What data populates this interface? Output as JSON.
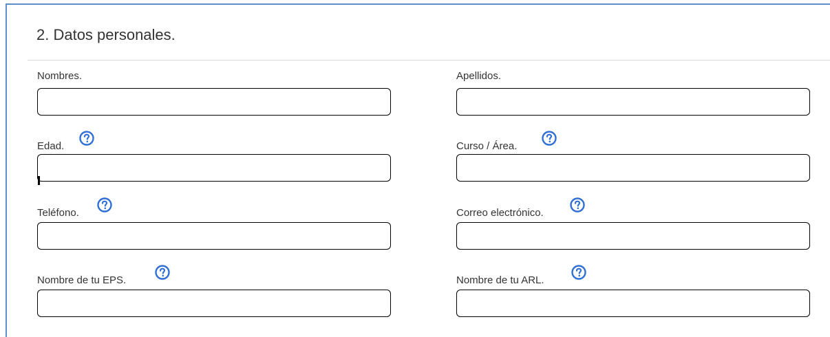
{
  "section": {
    "title": "2. Datos personales."
  },
  "fields": {
    "nombres": {
      "label": "Nombres.",
      "value": "",
      "has_help": false
    },
    "apellidos": {
      "label": "Apellidos.",
      "value": "",
      "has_help": false
    },
    "edad": {
      "label": "Edad.",
      "value": "",
      "has_help": true
    },
    "curso": {
      "label": "Curso / Área.",
      "value": "",
      "has_help": true
    },
    "telefono": {
      "label": "Teléfono.",
      "value": "",
      "has_help": true
    },
    "correo": {
      "label": "Correo electrónico.",
      "value": "",
      "has_help": true
    },
    "eps": {
      "label": "Nombre de tu EPS.",
      "value": "",
      "has_help": true
    },
    "arl": {
      "label": "Nombre de tu ARL.",
      "value": "",
      "has_help": true
    }
  },
  "icons": {
    "help": "question-circle-icon"
  },
  "colors": {
    "help_icon": "#2f6fd6",
    "panel_border": "#5b8fc9",
    "input_border": "#000000"
  }
}
